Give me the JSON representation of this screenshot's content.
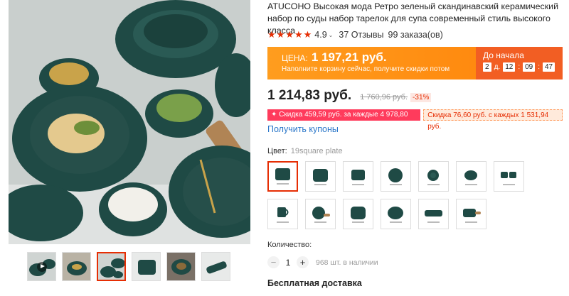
{
  "product": {
    "title": "ATUCOHO Высокая мода Ретро зеленый скандинавский керамический набор по суды набор тарелок для супа современный стиль высокого класса",
    "rating_score": "4.9",
    "reviews": "37 Отзывы",
    "orders": "99 заказа(ов)"
  },
  "promo": {
    "price_label": "ЦЕНА:",
    "price_value": "1 197,21 руб.",
    "subtitle": "Наполните корзину сейчас, получите скидки потом",
    "countdown_label": "До начала",
    "days": "2",
    "days_unit": "д.",
    "hours": "12",
    "minutes": "09",
    "seconds": "47"
  },
  "pricing": {
    "current": "1 214,83 руб.",
    "original": "1 760,96 руб.",
    "discount": "-31%"
  },
  "coupons": [
    {
      "text": "✦ Скидка 459,59 руб. за каждые 4 978,80 руб."
    },
    {
      "text": "Скидка 76,60 руб. с каждых 1 531,94 руб."
    }
  ],
  "get_coupons_label": "Получить купоны",
  "color": {
    "label": "Цвет:",
    "value": "19square plate"
  },
  "quantity": {
    "label": "Количество:",
    "value": "1",
    "minus": "−",
    "plus": "+",
    "stock": "968 шт. в наличии"
  },
  "shipping_label": "Бесплатная доставка",
  "colors": {
    "accent": "#e62e04",
    "promo_orange": "#ff9d1e",
    "promo_red": "#f25e23",
    "plate_green": "#1f4a45",
    "link": "#2b77c9"
  }
}
